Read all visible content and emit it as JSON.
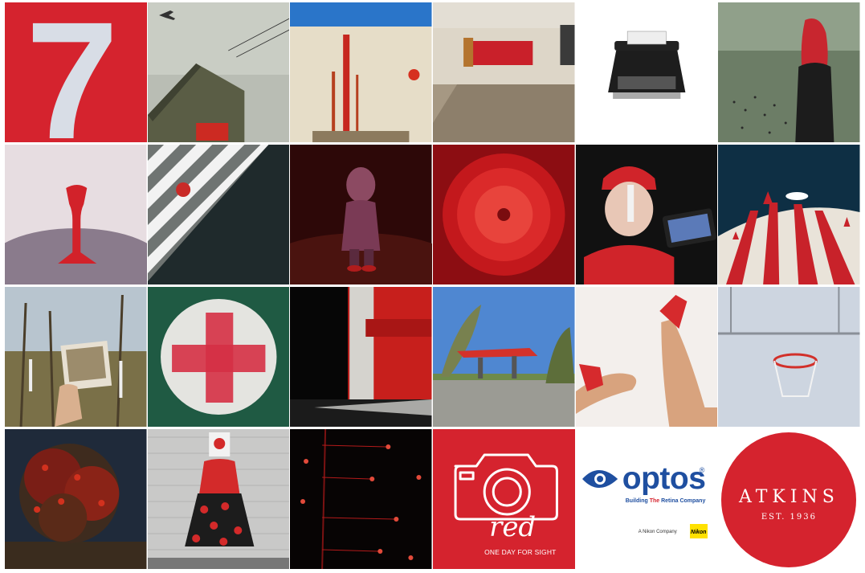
{
  "collage": {
    "rows": 4,
    "columns": 6,
    "accent_color": "#d5232e",
    "tiles": [
      {
        "name": "number-seven",
        "text": "7"
      },
      {
        "name": "shed-with-plane"
      },
      {
        "name": "red-poles-wall"
      },
      {
        "name": "empty-room-red-panel"
      },
      {
        "name": "typewriter"
      },
      {
        "name": "woman-red-scarf"
      },
      {
        "name": "red-telephone"
      },
      {
        "name": "zebra-crossing"
      },
      {
        "name": "doll-figurine"
      },
      {
        "name": "red-bundt-glass"
      },
      {
        "name": "woman-red-beanie"
      },
      {
        "name": "circus-tent"
      },
      {
        "name": "hand-holding-photo"
      },
      {
        "name": "red-cross-circle"
      },
      {
        "name": "red-brick-building"
      },
      {
        "name": "petrol-station-canopy"
      },
      {
        "name": "red-shoes-legs"
      },
      {
        "name": "basketball-hoop"
      },
      {
        "name": "red-flowering-tree"
      },
      {
        "name": "woman-polka-skirt"
      },
      {
        "name": "red-lights-night"
      },
      {
        "name": "red-campaign-logo"
      },
      {
        "name": "optos-logo"
      },
      {
        "name": "atkins-logo"
      }
    ]
  },
  "red_logo": {
    "word": "red",
    "tagline": "ONE DAY FOR SIGHT"
  },
  "optos_logo": {
    "name": "optos",
    "registered": "®",
    "tagline_before": "Building ",
    "tagline_highlight": "The",
    "tagline_after": " Retina Company",
    "parent": "A Nikon Company",
    "parent_badge": "Nikon"
  },
  "atkins_logo": {
    "name": "ATKINS",
    "est": "EST. 1936"
  }
}
